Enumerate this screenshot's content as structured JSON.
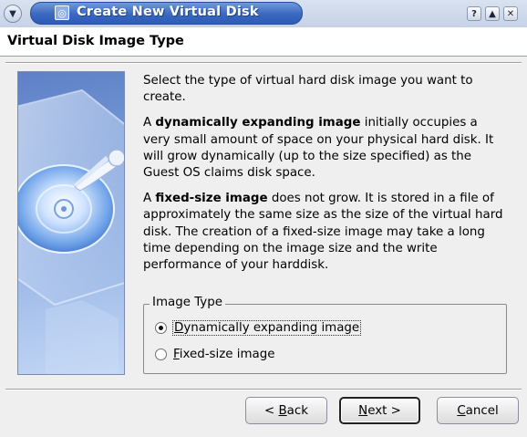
{
  "window": {
    "title": "Create New Virtual Disk",
    "controls": [
      "?",
      "▲",
      "✕"
    ]
  },
  "page": {
    "heading": "Virtual Disk Image Type",
    "intro": "Select the type of virtual hard disk image you want to create.",
    "dynamic_bold": "dynamically expanding image",
    "dynamic_pre": "A ",
    "dynamic_rest": " initially occupies a very small amount of space on your physical hard disk. It will grow dynamically (up to the size specified) as the Guest OS claims disk space.",
    "fixed_pre": "A ",
    "fixed_bold": "fixed-size image",
    "fixed_rest": " does not grow. It is stored in a file of approximately the same size as the size of the virtual hard disk. The creation of a fixed-size image may take a long time depending on the image size and the write performance of your harddisk."
  },
  "image_type": {
    "legend": "Image Type",
    "options": [
      {
        "mnemonic": "D",
        "rest": "ynamically expanding image",
        "checked": true
      },
      {
        "mnemonic": "F",
        "rest": "ixed-size image",
        "checked": false
      }
    ]
  },
  "buttons": {
    "back_prefix": "< ",
    "back_mnemonic": "B",
    "back_rest": "ack",
    "next_mnemonic": "N",
    "next_rest": "ext >",
    "cancel_mnemonic": "C",
    "cancel_rest": "ancel"
  },
  "icons": {
    "menu": "window-menu-icon",
    "app": "virtualbox-app-icon",
    "side": "hard-disk-illustration-icon"
  },
  "colors": {
    "title_bar": "#3a68c0",
    "window_bg": "#efefef"
  }
}
